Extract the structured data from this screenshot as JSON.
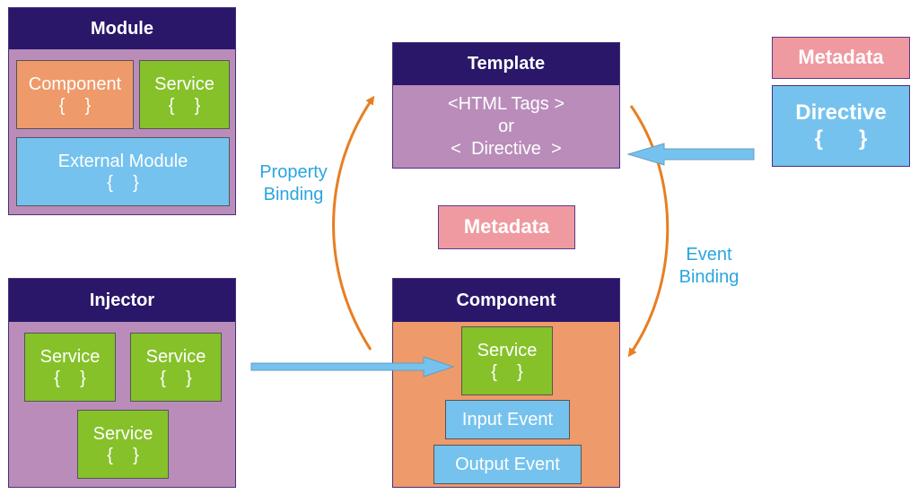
{
  "module": {
    "title": "Module",
    "component": {
      "label": "Component",
      "braces": "{    }"
    },
    "service": {
      "label": "Service",
      "braces": "{    }"
    },
    "external": {
      "label": "External Module",
      "braces": "{    }"
    }
  },
  "injector": {
    "title": "Injector",
    "services": [
      {
        "label": "Service",
        "braces": "{    }"
      },
      {
        "label": "Service",
        "braces": "{    }"
      },
      {
        "label": "Service",
        "braces": "{    }"
      }
    ]
  },
  "template": {
    "title": "Template",
    "lines": [
      "<HTML Tags >",
      "or",
      "<  Directive  >"
    ]
  },
  "component": {
    "title": "Component",
    "service": {
      "label": "Service",
      "braces": "{    }"
    },
    "input_event": "Input Event",
    "output_event": "Output Event"
  },
  "metadata_center": "Metadata",
  "metadata_right": "Metadata",
  "directive": {
    "label": "Directive",
    "braces": "{      }"
  },
  "labels": {
    "property_binding": [
      "Property",
      "Binding"
    ],
    "event_binding": [
      "Event",
      "Binding"
    ]
  },
  "colors": {
    "header": "#2a176a",
    "panel": "#b98cba",
    "component_orange": "#ee9a6a",
    "service_green": "#86c12a",
    "blue": "#75c2ee",
    "metadata_pink": "#ef9aa0",
    "arrow_orange": "#e87e22",
    "label_blue": "#2aa5e0"
  }
}
